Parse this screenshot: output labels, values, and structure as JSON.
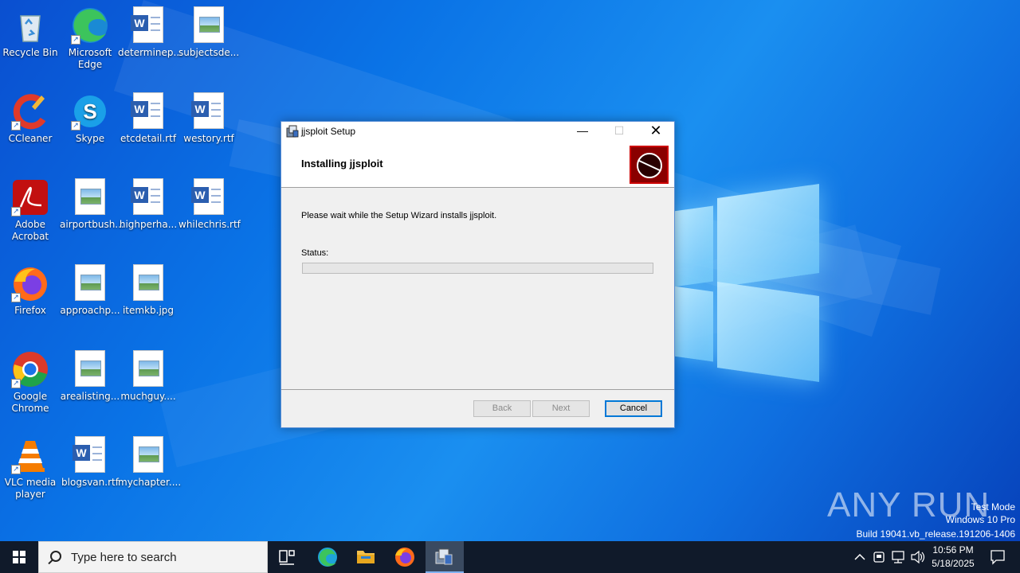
{
  "desktop": {
    "icons": [
      {
        "label": "Recycle Bin",
        "icon": "recycle-bin-icon"
      },
      {
        "label": "Microsoft Edge",
        "icon": "edge-icon"
      },
      {
        "label": "determinep...",
        "icon": "word-doc-icon"
      },
      {
        "label": "subjectsde...",
        "icon": "image-file-icon"
      },
      {
        "label": "CCleaner",
        "icon": "ccleaner-icon"
      },
      {
        "label": "Skype",
        "icon": "skype-icon"
      },
      {
        "label": "etcdetail.rtf",
        "icon": "word-doc-icon"
      },
      {
        "label": "westory.rtf",
        "icon": "word-doc-icon"
      },
      {
        "label": "Adobe Acrobat",
        "icon": "acrobat-icon"
      },
      {
        "label": "airportbush...",
        "icon": "image-file-icon"
      },
      {
        "label": "highperha...",
        "icon": "word-doc-icon"
      },
      {
        "label": "whilechris.rtf",
        "icon": "word-doc-icon"
      },
      {
        "label": "Firefox",
        "icon": "firefox-icon"
      },
      {
        "label": "approachp...",
        "icon": "image-file-icon"
      },
      {
        "label": "itemkb.jpg",
        "icon": "image-file-icon"
      },
      {
        "label": "Google Chrome",
        "icon": "chrome-icon"
      },
      {
        "label": "arealisting...",
        "icon": "image-file-icon"
      },
      {
        "label": "muchguy....",
        "icon": "image-file-icon"
      },
      {
        "label": "VLC media player",
        "icon": "vlc-icon"
      },
      {
        "label": "blogsvan.rtf",
        "icon": "word-doc-icon"
      },
      {
        "label": "mychapter....",
        "icon": "image-file-icon"
      }
    ]
  },
  "setup_window": {
    "title": "jjsploit Setup",
    "heading": "Installing jjsploit",
    "message": "Please wait while the Setup Wizard installs jjsploit.",
    "status_label": "Status:",
    "progress_fraction": 0,
    "buttons": {
      "back": "Back",
      "next": "Next",
      "cancel": "Cancel"
    }
  },
  "watermark": {
    "brand": "ANY RUN",
    "line1": "Test Mode",
    "line2": "Windows 10 Pro",
    "line3": "Build 19041.vb_release.191206-1406"
  },
  "taskbar": {
    "search_placeholder": "Type here to search",
    "time": "10:56 PM",
    "date": "5/18/2025",
    "pinned": [
      "task-view-icon",
      "edge-icon",
      "file-explorer-icon",
      "firefox-icon",
      "installer-icon"
    ]
  }
}
